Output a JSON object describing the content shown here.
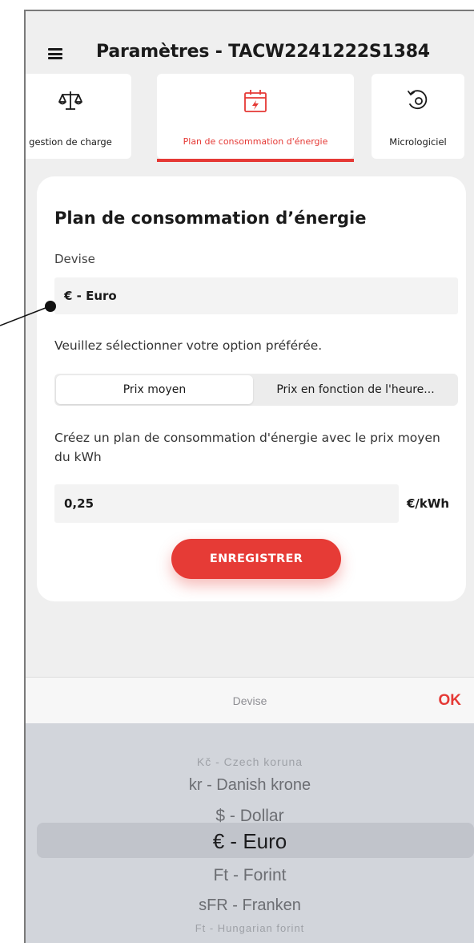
{
  "header": {
    "title": "Paramètres - TACW2241222S1384"
  },
  "tabs": [
    {
      "label": "gestion de charge",
      "icon": "balance-scale-icon"
    },
    {
      "label": "Plan de consommation d'énergie",
      "icon": "calendar-energy-icon",
      "active": true
    },
    {
      "label": "Micrologiciel",
      "icon": "firmware-update-icon"
    }
  ],
  "card": {
    "title": "Plan de consommation d’énergie",
    "currency_label": "Devise",
    "currency_value": "€ - Euro",
    "option_prompt": "Veuillez sélectionner votre option préférée.",
    "segments": [
      "Prix moyen",
      "Prix en fonction de l'heure..."
    ],
    "plan_description": "Créez un plan de consommation d'énergie avec le prix moyen du kWh",
    "price_value": "0,25",
    "price_unit": "€/kWh",
    "save_label": "ENREGISTRER"
  },
  "picker": {
    "title": "Devise",
    "ok_label": "OK",
    "options": [
      "Kč - Czech koruna",
      "kr - Danish krone",
      "$ - Dollar",
      "€ - Euro",
      "Ft - Forint",
      "sFR - Franken",
      "Ft - Hungarian forint"
    ],
    "selected": "€ - Euro"
  },
  "colors": {
    "accent": "#e53935",
    "button": "#e63b36",
    "background": "#efefef",
    "picker_bg": "#d2d5db"
  }
}
